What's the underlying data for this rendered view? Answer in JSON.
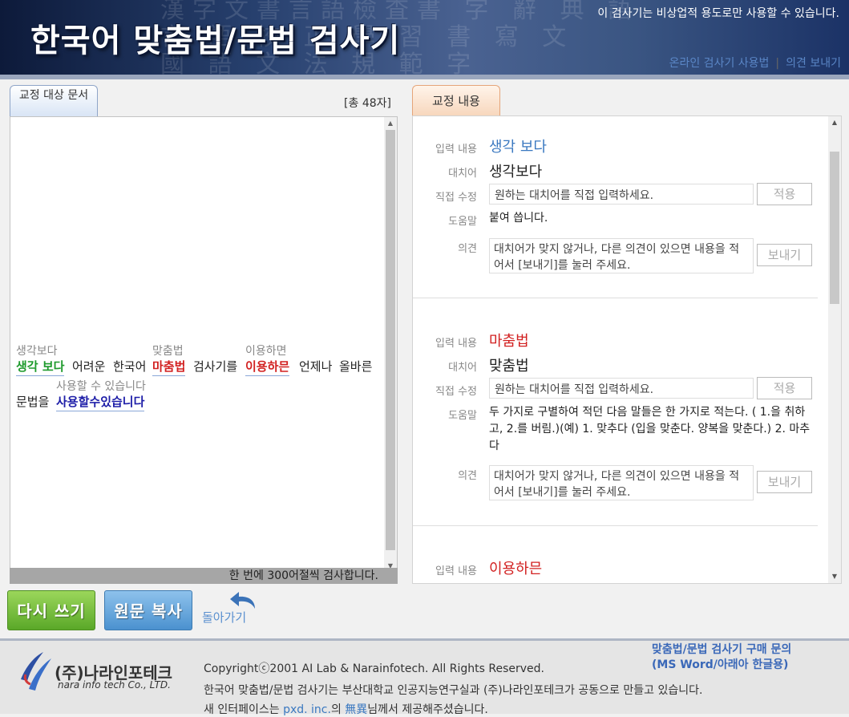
{
  "header": {
    "logo_text": "한국어 맞춤법/문법 검사기",
    "notice": "이 검사기는 비상업적 용도로만 사용할 수 있습니다.",
    "links": [
      "온라인 검사기 사용법",
      "의견 보내기"
    ],
    "link_separator": "|"
  },
  "left_panel": {
    "tab_label": "교정 대상 문서",
    "char_count": "[총 48자]",
    "footer_note": "한 번에 300어절씩 검사합니다.",
    "lines": [
      {
        "words": [
          {
            "text": "생각 보다",
            "suggestion": "생각보다",
            "color": "green",
            "error": true
          },
          {
            "text": "어려운",
            "error": false
          },
          {
            "text": "한국어",
            "error": false
          },
          {
            "text": "마춤법",
            "suggestion": "맞춤법",
            "color": "red",
            "error": true
          },
          {
            "text": "검사기를",
            "error": false
          },
          {
            "text": "이용하믄",
            "suggestion": "이용하면",
            "color": "red",
            "error": true
          },
          {
            "text": "언제나",
            "error": false
          },
          {
            "text": "올바른",
            "error": false
          }
        ]
      },
      {
        "words": [
          {
            "text": "문법을",
            "error": false
          },
          {
            "text": "사용할수있습니다",
            "suggestion": "사용할 수 있습니다",
            "color": "blue",
            "error": true
          }
        ]
      }
    ]
  },
  "right_panel": {
    "tab_label": "교정 내용",
    "labels": {
      "input": "입력 내용",
      "replace": "대치어",
      "direct": "직접 수정",
      "help": "도움말",
      "opinion": "의견"
    },
    "direct_placeholder": "원하는 대치어를 직접 입력하세요.",
    "opinion_placeholder": "대치어가 맞지 않거나, 다른 의견이 있으면 내용을 적어서 [보내기]를 눌러 주세요.",
    "apply_label": "적용",
    "send_label": "보내기",
    "items": [
      {
        "input": "생각 보다",
        "replace": "생각보다",
        "help": "붙여 씁니다.",
        "color": "#3a78c0"
      },
      {
        "input": "마춤법",
        "replace": "맞춤법",
        "help": "두 가지로 구별하여 적던 다음 말들은 한 가지로 적는다. ( 1.을 취하고, 2.를 버림.)(예) 1. 맞추다 (입을 맞춘다. 양복을 맞춘다.) 2. 마추다",
        "color": "#d22121"
      },
      {
        "input": "이용하믄",
        "color": "#d22121"
      }
    ]
  },
  "buttons": {
    "rewrite": "다시 쓰기",
    "copy_original": "원문 복사",
    "back": "돌아가기"
  },
  "footer": {
    "company_ko": "(주)나라인포테크",
    "company_en": "nara info tech Co., LTD.",
    "copyright": "Copyrightⓒ2001 AI Lab & Narainfotech. All Rights Reserved.",
    "credit": "한국어 맞춤법/문법 검사기는 부산대학교 인공지능연구실과 (주)나라인포테크가 공동으로 만들고 있습니다.",
    "interface_prefix": "새 인터페이스는 ",
    "interface_link1": "pxd. inc.",
    "interface_mid": "의 ",
    "interface_link2": "無異",
    "interface_suffix": "님께서 제공해주셨습니다.",
    "buy_inquiry_1": "맞춤법/문법 검사기 구매 문의",
    "buy_inquiry_2": "(MS Word/아래아 한글용)"
  }
}
